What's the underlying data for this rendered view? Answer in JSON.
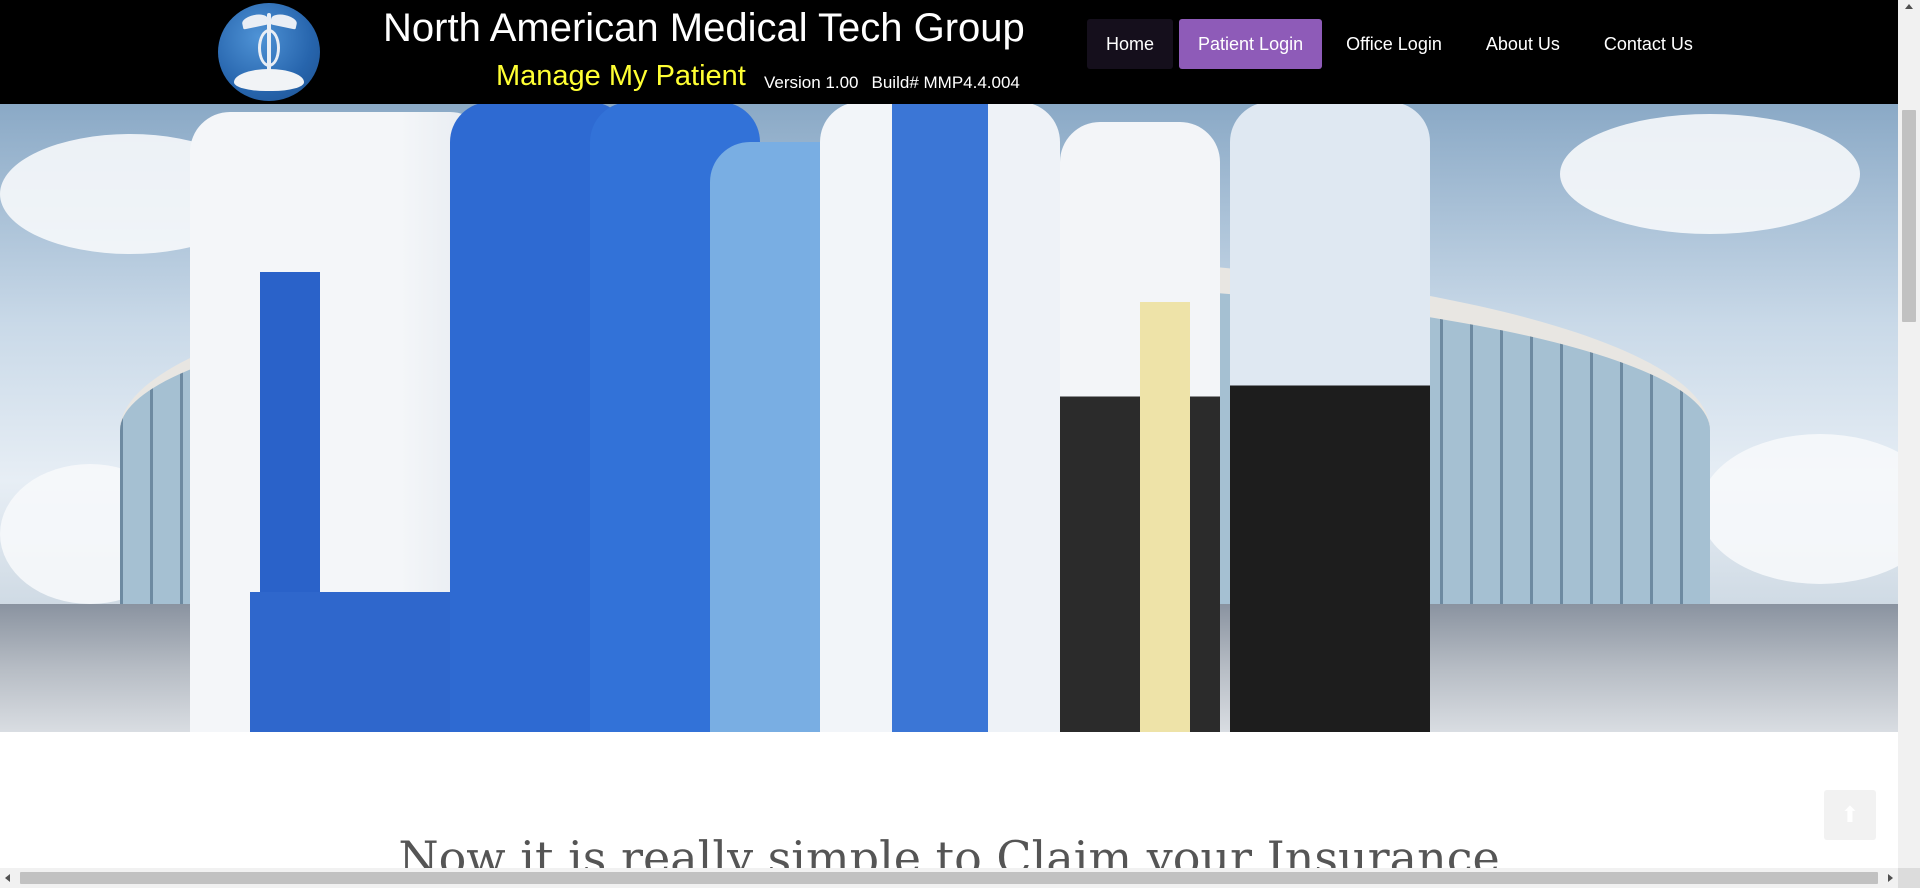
{
  "header": {
    "logo_icon": "caduceus-hand-logo",
    "title": "North American Medical Tech Group",
    "subtitle": "Manage My Patient",
    "version": "Version 1.00",
    "build": "Build# MMP4.4.004",
    "background_color": "#000000",
    "title_color": "#ffffff",
    "subtitle_color": "#ffff33"
  },
  "nav": {
    "items": [
      {
        "label": "Home"
      },
      {
        "label": "Patient Login",
        "active": true
      },
      {
        "label": "Office Login"
      },
      {
        "label": "About Us"
      },
      {
        "label": "Contact Us"
      }
    ],
    "active_color": "#8e5bb8"
  },
  "hero": {
    "image": "medical-team-photo"
  },
  "content": {
    "heading": "Now it is really simple to Claim your Insurance"
  },
  "back_to_top": {
    "icon": "arrow-up-icon",
    "glyph": "⬆"
  }
}
